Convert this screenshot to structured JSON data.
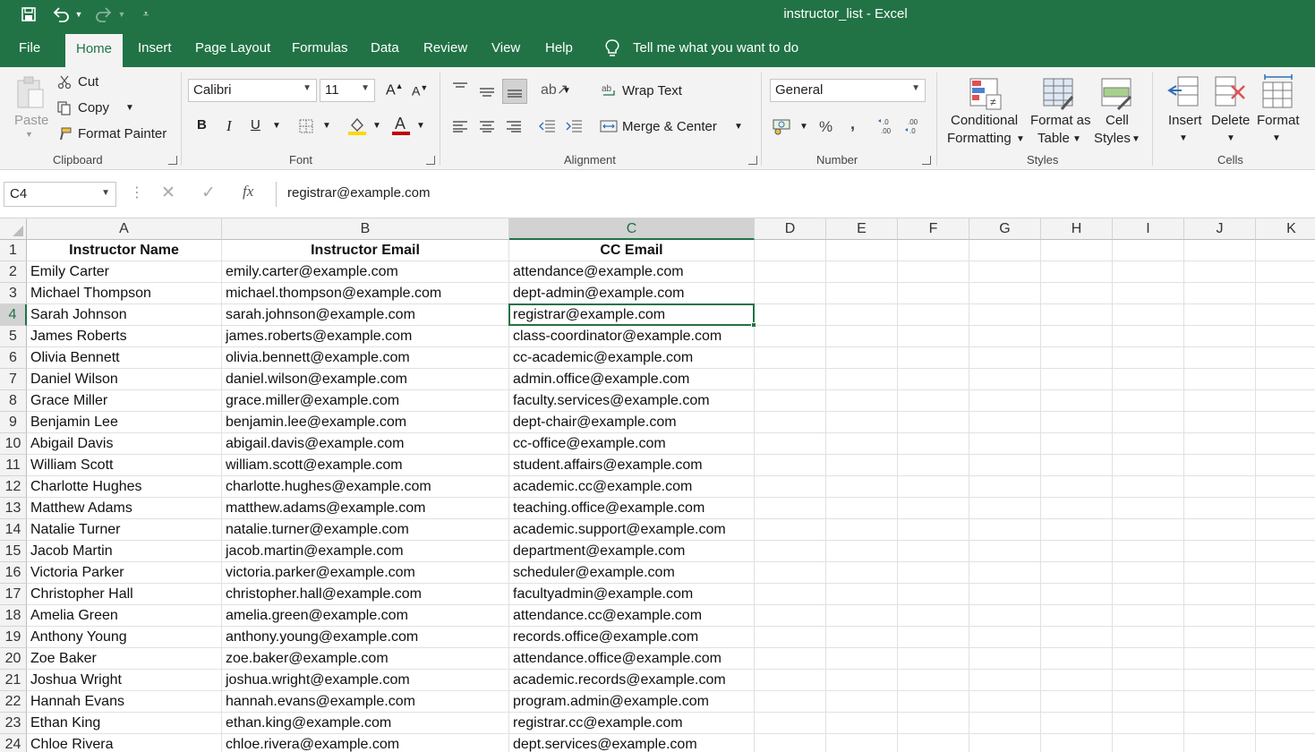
{
  "window": {
    "title": "instructor_list  -  Excel"
  },
  "tabs": [
    "File",
    "Home",
    "Insert",
    "Page Layout",
    "Formulas",
    "Data",
    "Review",
    "View",
    "Help"
  ],
  "active_tab": "Home",
  "tell_me": "Tell me what you want to do",
  "ribbon": {
    "clipboard": {
      "label": "Clipboard",
      "paste": "Paste",
      "cut": "Cut",
      "copy": "Copy",
      "format_painter": "Format Painter"
    },
    "font": {
      "label": "Font",
      "font_name": "Calibri",
      "font_size": "11",
      "bold": "B",
      "italic": "I",
      "underline": "U"
    },
    "alignment": {
      "label": "Alignment",
      "wrap_text": "Wrap Text",
      "merge_center": "Merge & Center"
    },
    "number": {
      "label": "Number",
      "format": "General",
      "percent": "%",
      "comma": ","
    },
    "styles": {
      "label": "Styles",
      "conditional_1": "Conditional",
      "conditional_2": "Formatting",
      "format_table_1": "Format as",
      "format_table_2": "Table",
      "cell_styles_1": "Cell",
      "cell_styles_2": "Styles"
    },
    "cells": {
      "label": "Cells",
      "insert": "Insert",
      "delete": "Delete",
      "format": "Format"
    }
  },
  "formula_bar": {
    "name_box": "C4",
    "fx": "fx",
    "value": "registrar@example.com"
  },
  "columns": [
    "A",
    "B",
    "C",
    "D",
    "E",
    "F",
    "G",
    "H",
    "I",
    "J",
    "K"
  ],
  "selected_cell": {
    "row": 4,
    "col": "C"
  },
  "rows": [
    [
      "Instructor Name",
      "Instructor Email",
      "CC Email"
    ],
    [
      "Emily Carter",
      "emily.carter@example.com",
      "attendance@example.com"
    ],
    [
      "Michael Thompson",
      "michael.thompson@example.com",
      "dept-admin@example.com"
    ],
    [
      "Sarah Johnson",
      "sarah.johnson@example.com",
      "registrar@example.com"
    ],
    [
      "James Roberts",
      "james.roberts@example.com",
      "class-coordinator@example.com"
    ],
    [
      "Olivia Bennett",
      "olivia.bennett@example.com",
      "cc-academic@example.com"
    ],
    [
      "Daniel Wilson",
      "daniel.wilson@example.com",
      "admin.office@example.com"
    ],
    [
      "Grace Miller",
      "grace.miller@example.com",
      "faculty.services@example.com"
    ],
    [
      "Benjamin Lee",
      "benjamin.lee@example.com",
      "dept-chair@example.com"
    ],
    [
      "Abigail Davis",
      "abigail.davis@example.com",
      "cc-office@example.com"
    ],
    [
      "William Scott",
      "william.scott@example.com",
      "student.affairs@example.com"
    ],
    [
      "Charlotte Hughes",
      "charlotte.hughes@example.com",
      "academic.cc@example.com"
    ],
    [
      "Matthew Adams",
      "matthew.adams@example.com",
      "teaching.office@example.com"
    ],
    [
      "Natalie Turner",
      "natalie.turner@example.com",
      "academic.support@example.com"
    ],
    [
      "Jacob Martin",
      "jacob.martin@example.com",
      "department@example.com"
    ],
    [
      "Victoria Parker",
      "victoria.parker@example.com",
      "scheduler@example.com"
    ],
    [
      "Christopher Hall",
      "christopher.hall@example.com",
      "facultyadmin@example.com"
    ],
    [
      "Amelia Green",
      "amelia.green@example.com",
      "attendance.cc@example.com"
    ],
    [
      "Anthony Young",
      "anthony.young@example.com",
      "records.office@example.com"
    ],
    [
      "Zoe Baker",
      "zoe.baker@example.com",
      "attendance.office@example.com"
    ],
    [
      "Joshua Wright",
      "joshua.wright@example.com",
      "academic.records@example.com"
    ],
    [
      "Hannah Evans",
      "hannah.evans@example.com",
      "program.admin@example.com"
    ],
    [
      "Ethan King",
      "ethan.king@example.com",
      "registrar.cc@example.com"
    ],
    [
      "Chloe Rivera",
      "chloe.rivera@example.com",
      "dept.services@example.com"
    ]
  ],
  "colors": {
    "accent": "#217346",
    "ribbon_bg": "#f3f3f3",
    "font_color": "#c00000",
    "highlight": "#ffd800"
  }
}
